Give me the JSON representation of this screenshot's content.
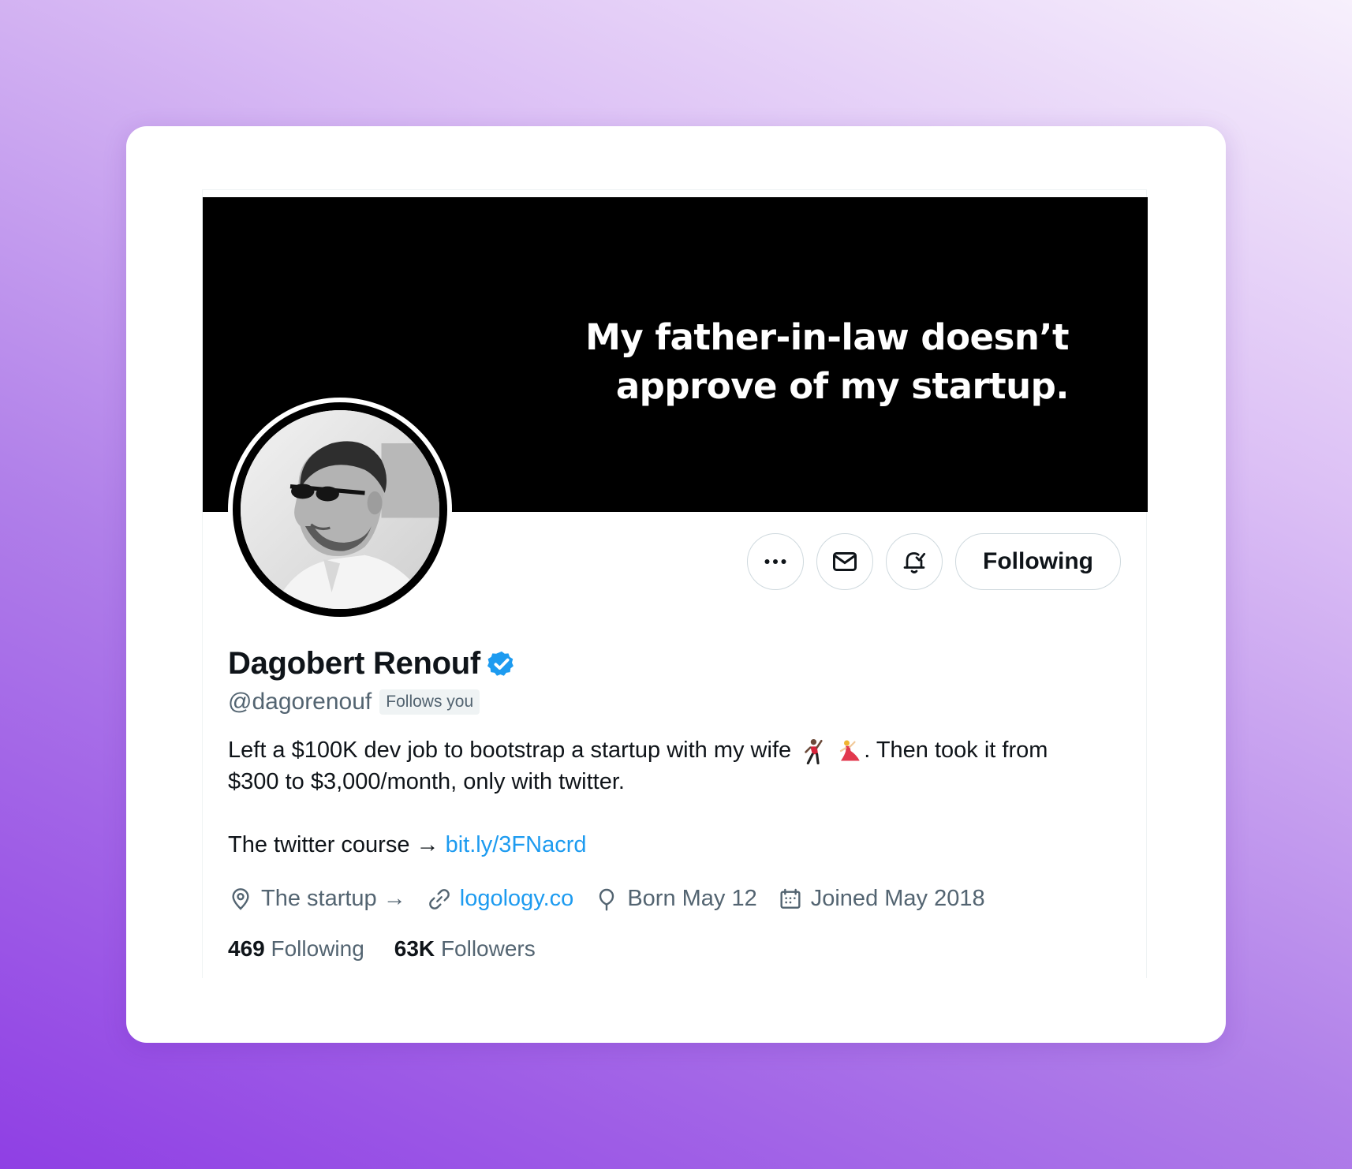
{
  "banner": {
    "line1": "My father-in-law doesn’t",
    "line2": "approve of my startup."
  },
  "actions": {
    "more_icon": "more-icon",
    "message_icon": "envelope-icon",
    "notify_icon": "bell-check-icon",
    "following_label": "Following"
  },
  "profile": {
    "name": "Dagobert Renouf",
    "handle": "@dagorenouf",
    "follows_you": "Follows you",
    "verified_color": "#1d9bf0"
  },
  "bio": {
    "line1_before": "Left a $100K dev job to bootstrap a startup with my wife",
    "line1_after": ". Then took it from",
    "line2": "$300 to $3,000/month, only with twitter.",
    "course_text": "The twitter course →",
    "course_link": "bit.ly/3FNacrd"
  },
  "meta": {
    "location": "The startup →",
    "website": "logology.co",
    "born": "Born May 12",
    "joined": "Joined May 2018"
  },
  "stats": {
    "following_count": "469",
    "following_label": "Following",
    "followers_count": "63K",
    "followers_label": "Followers"
  },
  "colors": {
    "link": "#1d9bf0",
    "secondary_text": "#536471",
    "primary_text": "#0f1419"
  }
}
